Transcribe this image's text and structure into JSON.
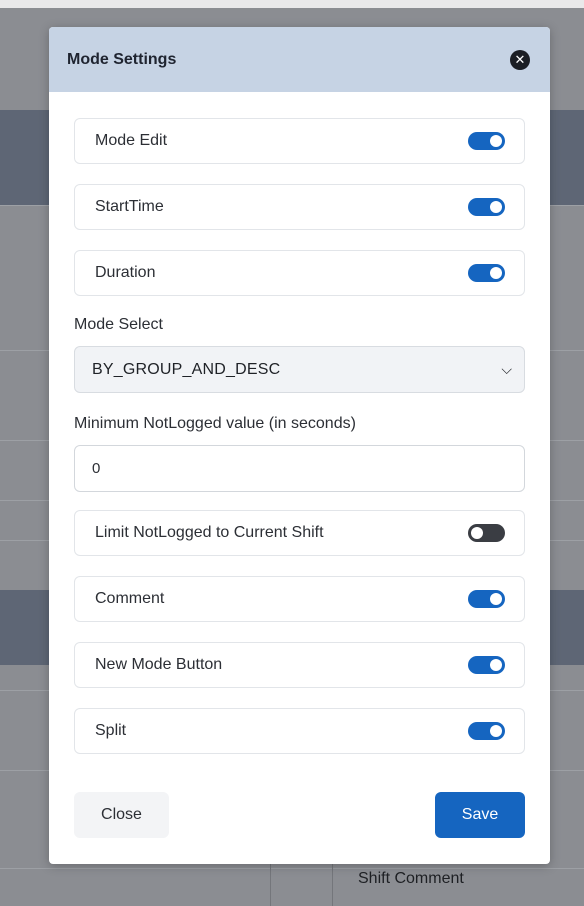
{
  "modal": {
    "title": "Mode Settings",
    "close_icon": "close-circle-icon"
  },
  "toggles_top": [
    {
      "label": "Mode Edit",
      "on": true
    },
    {
      "label": "StartTime",
      "on": true
    },
    {
      "label": "Duration",
      "on": true
    }
  ],
  "mode_select": {
    "label": "Mode Select",
    "value": "BY_GROUP_AND_DESC"
  },
  "min_notlogged": {
    "label": "Minimum NotLogged value (in seconds)",
    "value": "0"
  },
  "toggles_bottom": [
    {
      "label": "Limit NotLogged to Current Shift",
      "on": false
    },
    {
      "label": "Comment",
      "on": true
    },
    {
      "label": "New Mode Button",
      "on": true
    },
    {
      "label": "Split",
      "on": true
    }
  ],
  "footer": {
    "close_label": "Close",
    "save_label": "Save"
  },
  "background": {
    "visible_text": "Shift Comment"
  },
  "colors": {
    "header_bg": "#c6d3e4",
    "accent": "#1565c0",
    "toggle_off": "#3a3d43"
  }
}
